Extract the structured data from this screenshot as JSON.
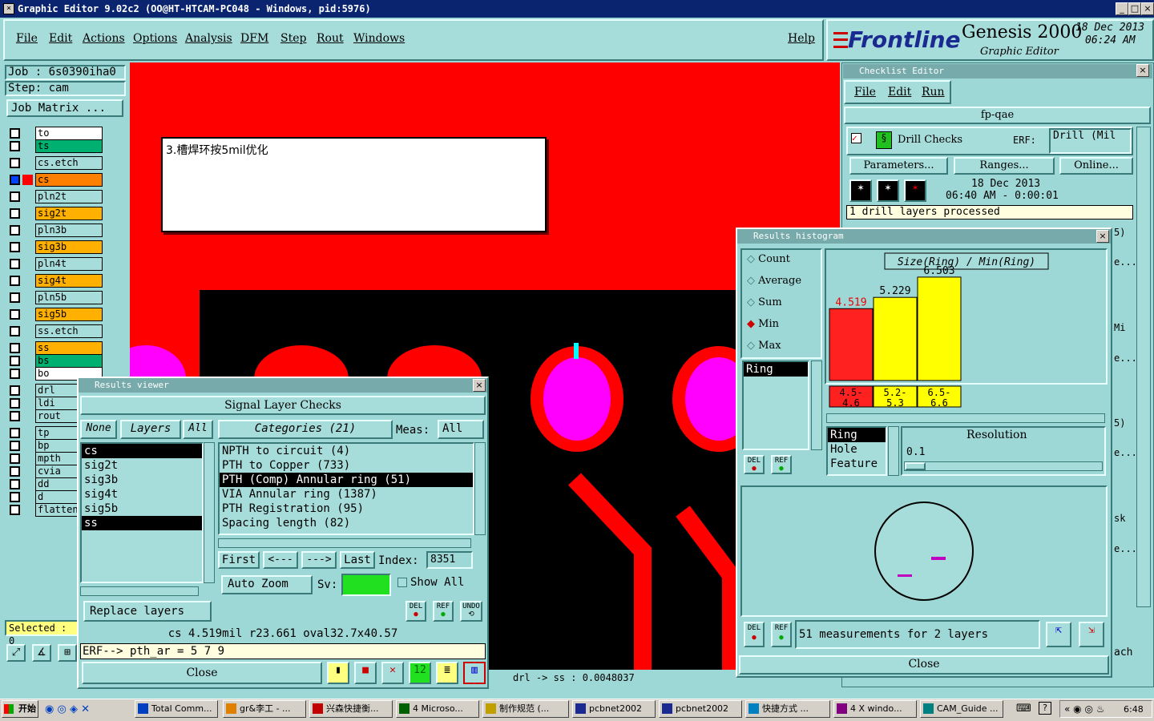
{
  "window": {
    "title": "Graphic Editor 9.02c2 (OO@HT-HTCAM-PC048 - Windows, pid:5976)"
  },
  "menu": {
    "items": [
      "File",
      "Edit",
      "Actions",
      "Options",
      "Analysis",
      "DFM",
      "Step",
      "Rout",
      "Windows"
    ],
    "help": "Help"
  },
  "brand": {
    "logo": "Frontline",
    "product": "Genesis 2000",
    "subtitle": "Graphic Editor",
    "date": "18 Dec 2013",
    "time": "06:24 AM"
  },
  "job": {
    "job": "Job : 6s0390iha0",
    "step": "Step: cam",
    "matrix": "Job Matrix ..."
  },
  "layers": [
    "to",
    "ts",
    "cs.etch",
    "cs",
    "pln2t",
    "sig2t",
    "pln3b",
    "sig3b",
    "pln4t",
    "sig4t",
    "pln5b",
    "sig5b",
    "ss.etch",
    "ss",
    "bs",
    "bo",
    "drl",
    "ldi",
    "rout",
    "tp",
    "bp",
    "mpth",
    "cvia",
    "dd",
    "d",
    "flatten"
  ],
  "selected_label": "Selected : 0",
  "note": {
    "text": "3.槽焊环按5mil优化"
  },
  "status": {
    "drl_ss": "drl -> ss : 0.0048037"
  },
  "checklist": {
    "title": "Checklist Editor",
    "menu": [
      "File",
      "Edit",
      "Run"
    ],
    "name": "fp-qae",
    "check": "Drill Checks",
    "erf_label": "ERF:",
    "erf_value": "Drill (Mil",
    "params": "Parameters...",
    "ranges": "Ranges...",
    "online": "Online...",
    "run_date": "18 Dec 2013",
    "run_time": "06:40 AM - 0:00:01",
    "processed": "1 drill layers processed"
  },
  "viewer": {
    "title": "Results viewer",
    "header": "Signal Layer Checks",
    "none": "None",
    "layers": "Layers",
    "all": "All",
    "categories": "Categories (21)",
    "meas": "Meas:",
    "meas_value": "All",
    "layer_list": [
      "cs",
      "sig2t",
      "sig3b",
      "sig4t",
      "sig5b",
      "ss"
    ],
    "category_list": [
      "NPTH to circuit (4)",
      "PTH to Copper (733)",
      "PTH (Comp) Annular ring (51)",
      "VIA Annular ring (1387)",
      "PTH Registration (95)",
      "Spacing length (82)"
    ],
    "first": "First",
    "prev": "<---",
    "next": "--->",
    "last": "Last",
    "index_label": "Index:",
    "index_value": "8351",
    "auto_zoom": "Auto Zoom",
    "sv": "Sv:",
    "show_all": "Show All",
    "replace": "Replace layers",
    "del": "DEL",
    "ref": "REF",
    "undo": "UNDO",
    "measure": "cs 4.519mil   r23.661   oval32.7x40.57",
    "erf": "ERF--> pth_ar = 5 7 9",
    "close": "Close"
  },
  "histogram": {
    "title": "Results histogram",
    "options": [
      "Count",
      "Average",
      "Sum",
      "Min",
      "Max"
    ],
    "selected_option": "Min",
    "ring": "Ring",
    "chart_title": "Size(Ring) / Min(Ring)",
    "features": [
      "Ring",
      "Hole",
      "Feature"
    ],
    "resolution": "Resolution",
    "resolution_value": "0.1",
    "measurements": "51 measurements for 2 layers",
    "close": "Close"
  },
  "chart_data": {
    "type": "bar",
    "title": "Size(Ring) / Min(Ring)",
    "categories": [
      "4.5-4.6",
      "5.2-5.3",
      "6.5-6.6"
    ],
    "values": [
      4.519,
      5.229,
      6.503
    ],
    "colors": [
      "#ff2020",
      "#ffff00",
      "#ffff00"
    ],
    "ylim": [
      0,
      6.8
    ]
  },
  "right_fragments": [
    "5)",
    "e...",
    "Mi",
    "e...",
    "5)",
    "e...",
    "sk",
    "e...",
    "ach"
  ],
  "taskbar": {
    "start": "开始",
    "items": [
      "Total Comm...",
      "gr&李工 - ...",
      "兴森快捷衡...",
      "4 Microso...",
      "制作规范 (...",
      "pcbnet2002",
      "pcbnet2002",
      "快捷方式 ...",
      "4 X windo...",
      "CAM_Guide ..."
    ],
    "clock": "6:48"
  }
}
